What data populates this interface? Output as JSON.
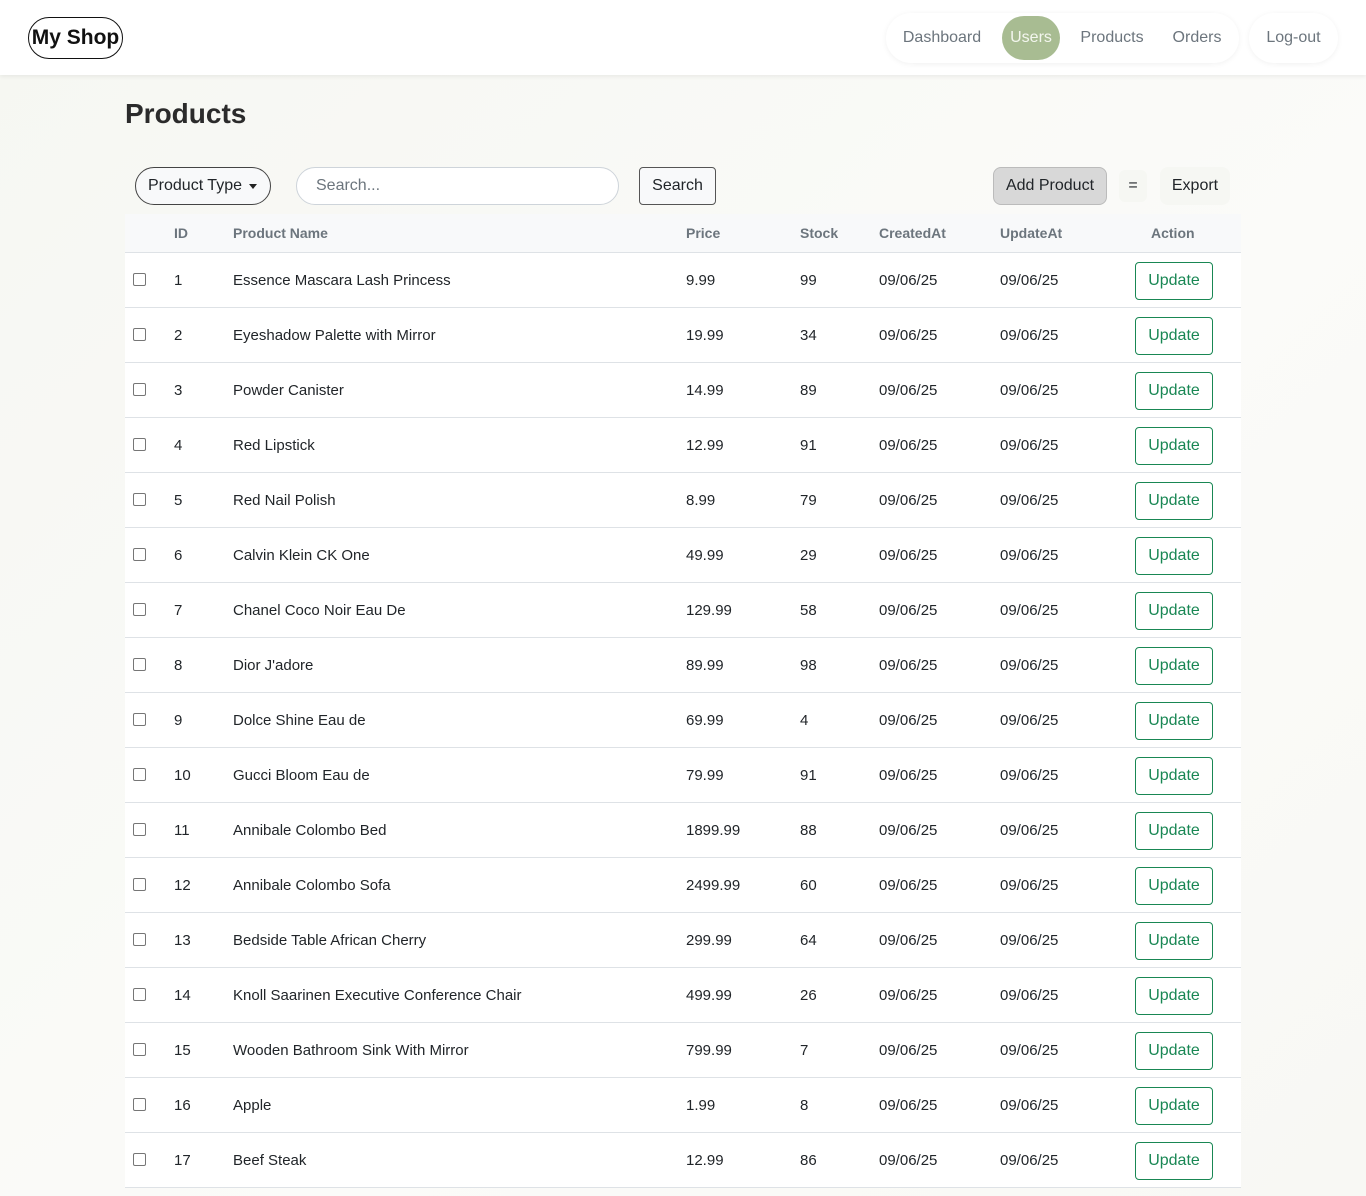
{
  "header": {
    "brand": "My Shop",
    "nav": [
      {
        "label": "Dashboard",
        "active": false
      },
      {
        "label": "Users",
        "active": true
      },
      {
        "label": "Products",
        "active": false
      },
      {
        "label": "Orders",
        "active": false
      }
    ],
    "logout": "Log-out",
    "active_color": "#a8bc92"
  },
  "page": {
    "title": "Products"
  },
  "toolbar": {
    "product_type_label": "Product Type",
    "search_placeholder": "Search...",
    "search_value": "",
    "search_button": "Search",
    "add_button": "Add Product",
    "equals_label": "=",
    "export_button": "Export"
  },
  "table": {
    "columns": [
      "ID",
      "Product Name",
      "Price",
      "Stock",
      "CreatedAt",
      "UpdateAt",
      "Action"
    ],
    "action_label": "Update",
    "action_color": "#198754",
    "rows": [
      {
        "id": "1",
        "name": "Essence Mascara Lash Princess",
        "price": "9.99",
        "stock": "99",
        "created": "09/06/25",
        "updated": "09/06/25"
      },
      {
        "id": "2",
        "name": "Eyeshadow Palette with Mirror",
        "price": "19.99",
        "stock": "34",
        "created": "09/06/25",
        "updated": "09/06/25"
      },
      {
        "id": "3",
        "name": "Powder Canister",
        "price": "14.99",
        "stock": "89",
        "created": "09/06/25",
        "updated": "09/06/25"
      },
      {
        "id": "4",
        "name": "Red Lipstick",
        "price": "12.99",
        "stock": "91",
        "created": "09/06/25",
        "updated": "09/06/25"
      },
      {
        "id": "5",
        "name": "Red Nail Polish",
        "price": "8.99",
        "stock": "79",
        "created": "09/06/25",
        "updated": "09/06/25"
      },
      {
        "id": "6",
        "name": "Calvin Klein CK One",
        "price": "49.99",
        "stock": "29",
        "created": "09/06/25",
        "updated": "09/06/25"
      },
      {
        "id": "7",
        "name": "Chanel Coco Noir Eau De",
        "price": "129.99",
        "stock": "58",
        "created": "09/06/25",
        "updated": "09/06/25"
      },
      {
        "id": "8",
        "name": "Dior J'adore",
        "price": "89.99",
        "stock": "98",
        "created": "09/06/25",
        "updated": "09/06/25"
      },
      {
        "id": "9",
        "name": "Dolce Shine Eau de",
        "price": "69.99",
        "stock": "4",
        "created": "09/06/25",
        "updated": "09/06/25"
      },
      {
        "id": "10",
        "name": "Gucci Bloom Eau de",
        "price": "79.99",
        "stock": "91",
        "created": "09/06/25",
        "updated": "09/06/25"
      },
      {
        "id": "11",
        "name": "Annibale Colombo Bed",
        "price": "1899.99",
        "stock": "88",
        "created": "09/06/25",
        "updated": "09/06/25"
      },
      {
        "id": "12",
        "name": "Annibale Colombo Sofa",
        "price": "2499.99",
        "stock": "60",
        "created": "09/06/25",
        "updated": "09/06/25"
      },
      {
        "id": "13",
        "name": "Bedside Table African Cherry",
        "price": "299.99",
        "stock": "64",
        "created": "09/06/25",
        "updated": "09/06/25"
      },
      {
        "id": "14",
        "name": "Knoll Saarinen Executive Conference Chair",
        "price": "499.99",
        "stock": "26",
        "created": "09/06/25",
        "updated": "09/06/25"
      },
      {
        "id": "15",
        "name": "Wooden Bathroom Sink With Mirror",
        "price": "799.99",
        "stock": "7",
        "created": "09/06/25",
        "updated": "09/06/25"
      },
      {
        "id": "16",
        "name": "Apple",
        "price": "1.99",
        "stock": "8",
        "created": "09/06/25",
        "updated": "09/06/25"
      },
      {
        "id": "17",
        "name": "Beef Steak",
        "price": "12.99",
        "stock": "86",
        "created": "09/06/25",
        "updated": "09/06/25"
      }
    ]
  }
}
